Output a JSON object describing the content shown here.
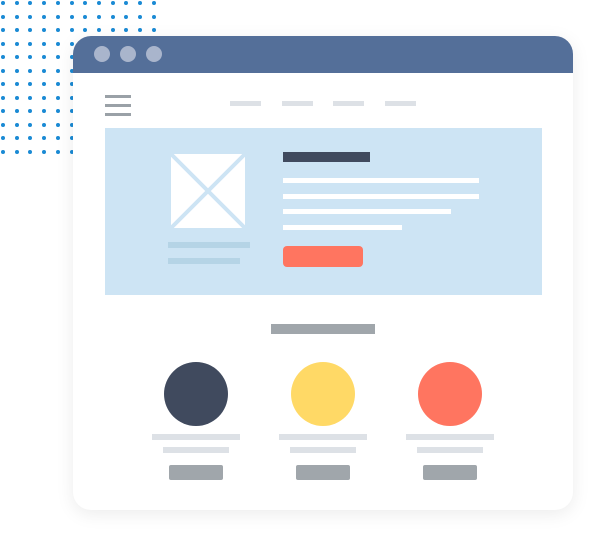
{
  "colors": {
    "dots": "#1a8ad4",
    "titlebar": "#546f99",
    "window_controls": "#a9b5cc",
    "menu_lines": "#9aa1a7",
    "nav_links": "#dde1e6",
    "hero_bg": "#cde4f4",
    "image_placeholder_lines": "#cde4f4",
    "heading_bar": "#404a5e",
    "hero_text_lines": "#ffffff",
    "hero_caption_lines": "#b5d4e6",
    "cta_button": "#ff7560",
    "section_title": "#a0a6ab",
    "text_lines": "#dde1e6",
    "card_buttons": "#a0a6ab"
  },
  "cards": [
    {
      "color": "#404a5e"
    },
    {
      "color": "#ffd966"
    },
    {
      "color": "#ff7560"
    }
  ]
}
